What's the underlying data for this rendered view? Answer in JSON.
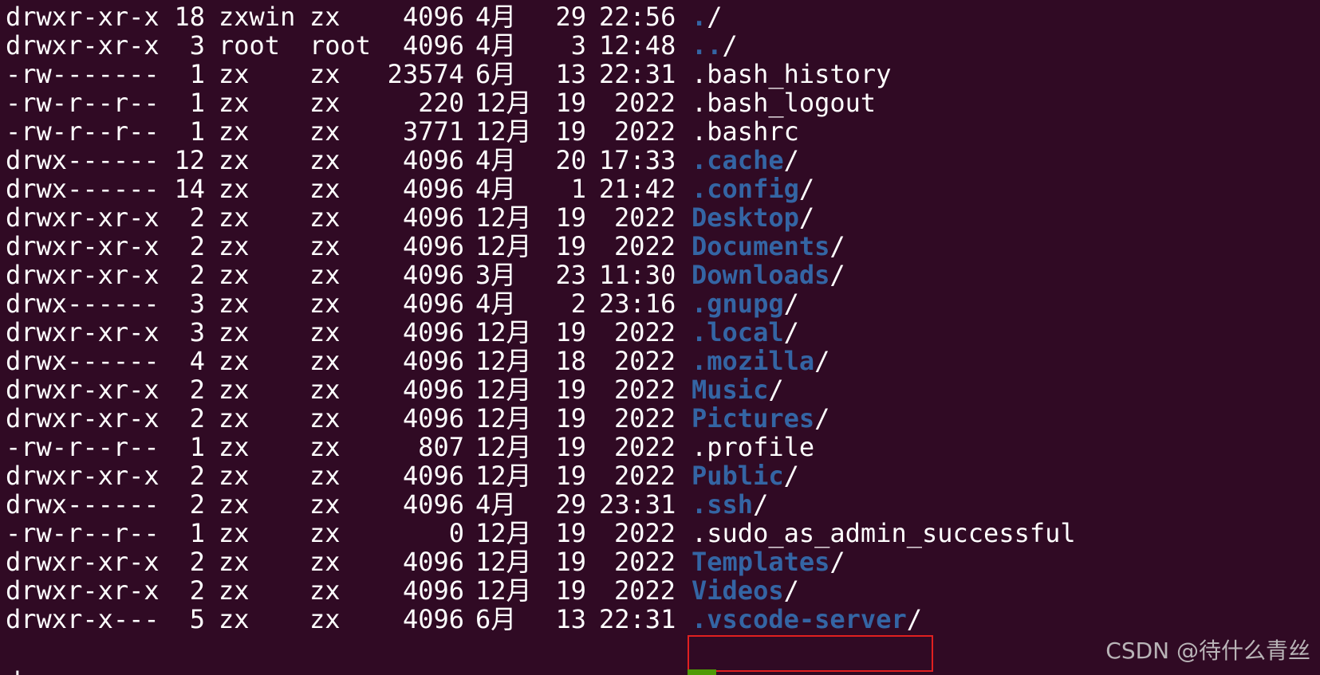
{
  "terminal": {
    "colors": {
      "background": "#300a24",
      "text": "#ffffff",
      "directory": "#3465a4",
      "highlight_box": "#e02020",
      "watermark": "#b9b4b7"
    },
    "rows": [
      {
        "perm": "drwxr-xr-x",
        "links": "18",
        "owner": "zxwin",
        "group": "zx",
        "size": "4096",
        "month": "4月",
        "day": "29",
        "time": "22:56",
        "name": ".",
        "is_dir": true
      },
      {
        "perm": "drwxr-xr-x",
        "links": "3",
        "owner": "root",
        "group": "root",
        "size": "4096",
        "month": "4月",
        "day": "3",
        "time": "12:48",
        "name": "..",
        "is_dir": true
      },
      {
        "perm": "-rw-------",
        "links": "1",
        "owner": "zx",
        "group": "zx",
        "size": "23574",
        "month": "6月",
        "day": "13",
        "time": "22:31",
        "name": ".bash_history",
        "is_dir": false
      },
      {
        "perm": "-rw-r--r--",
        "links": "1",
        "owner": "zx",
        "group": "zx",
        "size": "220",
        "month": "12月",
        "day": "19",
        "time": "2022",
        "name": ".bash_logout",
        "is_dir": false
      },
      {
        "perm": "-rw-r--r--",
        "links": "1",
        "owner": "zx",
        "group": "zx",
        "size": "3771",
        "month": "12月",
        "day": "19",
        "time": "2022",
        "name": ".bashrc",
        "is_dir": false
      },
      {
        "perm": "drwx------",
        "links": "12",
        "owner": "zx",
        "group": "zx",
        "size": "4096",
        "month": "4月",
        "day": "20",
        "time": "17:33",
        "name": ".cache",
        "is_dir": true
      },
      {
        "perm": "drwx------",
        "links": "14",
        "owner": "zx",
        "group": "zx",
        "size": "4096",
        "month": "4月",
        "day": "1",
        "time": "21:42",
        "name": ".config",
        "is_dir": true
      },
      {
        "perm": "drwxr-xr-x",
        "links": "2",
        "owner": "zx",
        "group": "zx",
        "size": "4096",
        "month": "12月",
        "day": "19",
        "time": "2022",
        "name": "Desktop",
        "is_dir": true
      },
      {
        "perm": "drwxr-xr-x",
        "links": "2",
        "owner": "zx",
        "group": "zx",
        "size": "4096",
        "month": "12月",
        "day": "19",
        "time": "2022",
        "name": "Documents",
        "is_dir": true
      },
      {
        "perm": "drwxr-xr-x",
        "links": "2",
        "owner": "zx",
        "group": "zx",
        "size": "4096",
        "month": "3月",
        "day": "23",
        "time": "11:30",
        "name": "Downloads",
        "is_dir": true
      },
      {
        "perm": "drwx------",
        "links": "3",
        "owner": "zx",
        "group": "zx",
        "size": "4096",
        "month": "4月",
        "day": "2",
        "time": "23:16",
        "name": ".gnupg",
        "is_dir": true
      },
      {
        "perm": "drwxr-xr-x",
        "links": "3",
        "owner": "zx",
        "group": "zx",
        "size": "4096",
        "month": "12月",
        "day": "19",
        "time": "2022",
        "name": ".local",
        "is_dir": true
      },
      {
        "perm": "drwx------",
        "links": "4",
        "owner": "zx",
        "group": "zx",
        "size": "4096",
        "month": "12月",
        "day": "18",
        "time": "2022",
        "name": ".mozilla",
        "is_dir": true
      },
      {
        "perm": "drwxr-xr-x",
        "links": "2",
        "owner": "zx",
        "group": "zx",
        "size": "4096",
        "month": "12月",
        "day": "19",
        "time": "2022",
        "name": "Music",
        "is_dir": true
      },
      {
        "perm": "drwxr-xr-x",
        "links": "2",
        "owner": "zx",
        "group": "zx",
        "size": "4096",
        "month": "12月",
        "day": "19",
        "time": "2022",
        "name": "Pictures",
        "is_dir": true
      },
      {
        "perm": "-rw-r--r--",
        "links": "1",
        "owner": "zx",
        "group": "zx",
        "size": "807",
        "month": "12月",
        "day": "19",
        "time": "2022",
        "name": ".profile",
        "is_dir": false
      },
      {
        "perm": "drwxr-xr-x",
        "links": "2",
        "owner": "zx",
        "group": "zx",
        "size": "4096",
        "month": "12月",
        "day": "19",
        "time": "2022",
        "name": "Public",
        "is_dir": true
      },
      {
        "perm": "drwx------",
        "links": "2",
        "owner": "zx",
        "group": "zx",
        "size": "4096",
        "month": "4月",
        "day": "29",
        "time": "23:31",
        "name": ".ssh",
        "is_dir": true
      },
      {
        "perm": "-rw-r--r--",
        "links": "1",
        "owner": "zx",
        "group": "zx",
        "size": "0",
        "month": "12月",
        "day": "19",
        "time": "2022",
        "name": ".sudo_as_admin_successful",
        "is_dir": false
      },
      {
        "perm": "drwxr-xr-x",
        "links": "2",
        "owner": "zx",
        "group": "zx",
        "size": "4096",
        "month": "12月",
        "day": "19",
        "time": "2022",
        "name": "Templates",
        "is_dir": true
      },
      {
        "perm": "drwxr-xr-x",
        "links": "2",
        "owner": "zx",
        "group": "zx",
        "size": "4096",
        "month": "12月",
        "day": "19",
        "time": "2022",
        "name": "Videos",
        "is_dir": true
      },
      {
        "perm": "drwxr-x---",
        "links": "5",
        "owner": "zx",
        "group": "zx",
        "size": "4096",
        "month": "6月",
        "day": "13",
        "time": "22:31",
        "name": ".vscode-server",
        "is_dir": true
      }
    ],
    "partial_row": {
      "perm": "d",
      "links": "",
      "owner": "",
      "group": "",
      "size": "",
      "month": "",
      "day": "",
      "time": "",
      "name": ""
    },
    "watermark": "CSDN @待什么青丝"
  }
}
